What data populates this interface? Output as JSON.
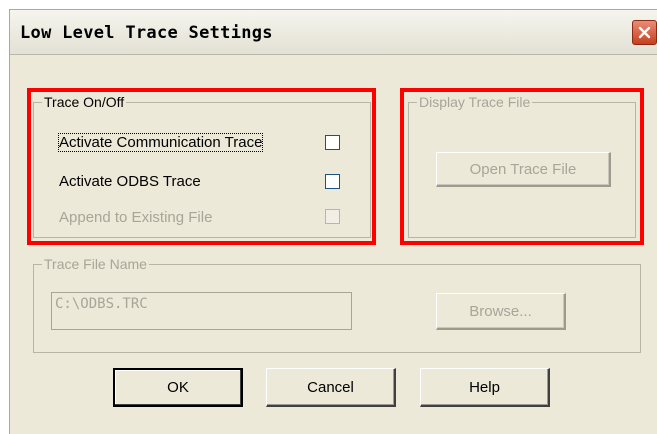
{
  "window": {
    "title": "Low Level Trace Settings"
  },
  "trace_group": {
    "legend": "Trace On/Off",
    "options": [
      {
        "label": "Activate Communication Trace",
        "checked": false,
        "enabled": true,
        "focused": true
      },
      {
        "label": "Activate ODBS Trace",
        "checked": false,
        "enabled": true,
        "focused": false
      },
      {
        "label": "Append to Existing File",
        "checked": false,
        "enabled": false,
        "focused": false
      }
    ]
  },
  "display_group": {
    "legend": "Display Trace File",
    "open_button": "Open Trace File",
    "enabled": false
  },
  "file_group": {
    "legend": "Trace File Name",
    "file_value": "C:\\ODBS.TRC",
    "browse_button": "Browse...",
    "enabled": false
  },
  "buttons": {
    "ok": "OK",
    "cancel": "Cancel",
    "help": "Help"
  },
  "colors": {
    "highlight": "#ff0000",
    "dialog_bg": "#ece9d8",
    "disabled_text": "#a7a59a"
  }
}
